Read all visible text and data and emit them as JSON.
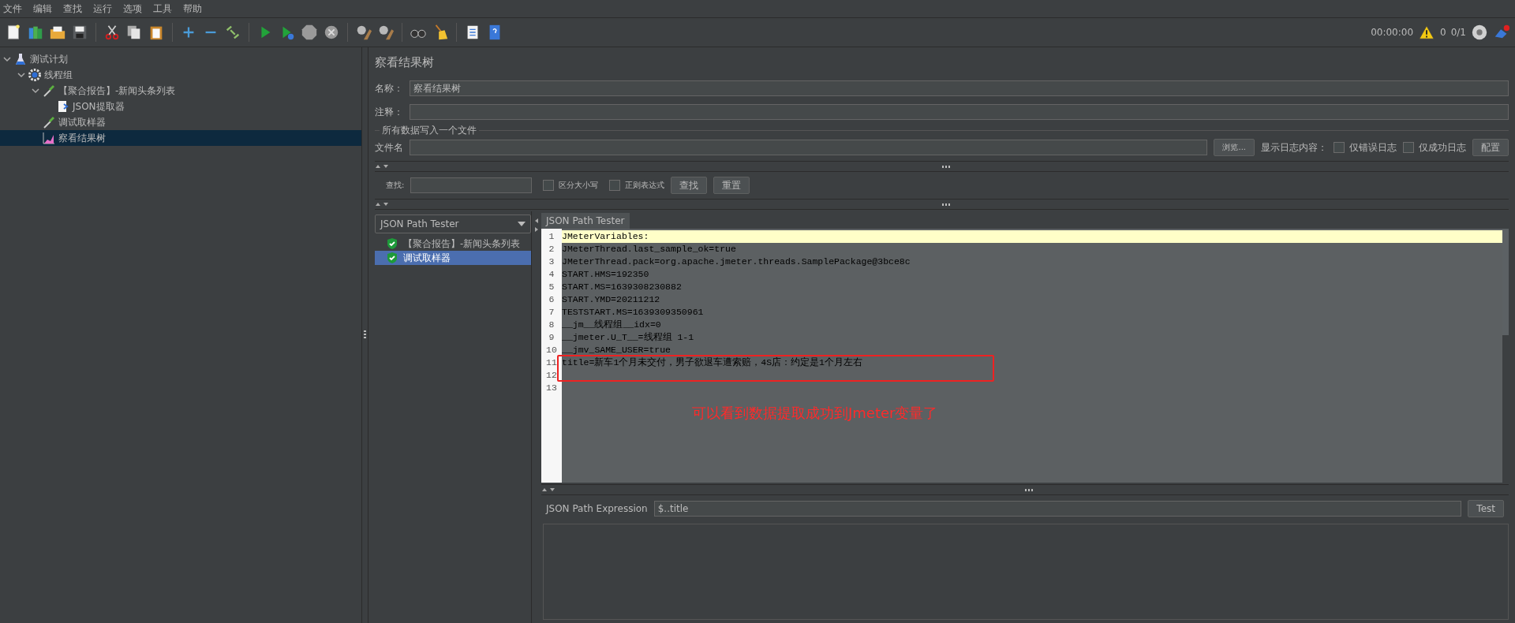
{
  "menu": [
    "文件",
    "编辑",
    "查找",
    "运行",
    "选项",
    "工具",
    "帮助"
  ],
  "status": {
    "time": "00:00:00",
    "warnings": "0",
    "threads": "0/1"
  },
  "tree": [
    {
      "label": "测试计划",
      "kind": "plan",
      "expanded": true,
      "selected": false,
      "children": [
        {
          "label": "线程组",
          "kind": "threads",
          "expanded": true,
          "selected": false,
          "children": [
            {
              "label": "【聚合报告】-新闻头条列表",
              "kind": "sampler",
              "expanded": true,
              "selected": false,
              "children": [
                {
                  "label": "JSON提取器",
                  "kind": "extractor",
                  "selected": false
                }
              ]
            },
            {
              "label": "调试取样器",
              "kind": "sampler",
              "selected": false
            },
            {
              "label": "察看结果树",
              "kind": "listener",
              "selected": true
            }
          ]
        }
      ]
    }
  ],
  "panel": {
    "title": "察看结果树",
    "name_label": "名称：",
    "name_value": "察看结果树",
    "comment_label": "注释：",
    "file_group": "所有数据写入一个文件",
    "file_label": "文件名",
    "browse": "浏览...",
    "log_label": "显示日志内容：",
    "log_options": [
      {
        "label": "仅错误日志",
        "checked": false
      },
      {
        "label": "仅成功日志",
        "checked": false
      }
    ],
    "config": "配置"
  },
  "search": {
    "label": "查找:",
    "options": [
      {
        "label": "区分大小写",
        "checked": false
      },
      {
        "label": "正则表达式",
        "checked": false
      }
    ],
    "find": "查找",
    "reset": "重置"
  },
  "renderer": "JSON Path Tester",
  "results": [
    {
      "label": "【聚合报告】-新闻头条列表",
      "selected": false
    },
    {
      "label": "调试取样器",
      "selected": true
    }
  ],
  "tab": "JSON Path Tester",
  "lines": [
    {
      "number": "1",
      "text": "JMeterVariables:",
      "current": true
    },
    {
      "number": "2",
      "text": "JMeterThread.last_sample_ok=true",
      "current": false
    },
    {
      "number": "3",
      "text": "JMeterThread.pack=org.apache.jmeter.threads.SamplePackage@3bce8c",
      "current": false
    },
    {
      "number": "4",
      "text": "START.HMS=192350",
      "current": false
    },
    {
      "number": "5",
      "text": "START.MS=1639308230882",
      "current": false
    },
    {
      "number": "6",
      "text": "START.YMD=20211212",
      "current": false
    },
    {
      "number": "7",
      "text": "TESTSTART.MS=1639309350961",
      "current": false
    },
    {
      "number": "8",
      "text": "__jm__线程组__idx=0",
      "current": false
    },
    {
      "number": "9",
      "text": "__jmeter.U_T__=线程组 1-1",
      "current": false
    },
    {
      "number": "10",
      "text": "__jmv_SAME_USER=true",
      "current": false
    },
    {
      "number": "11",
      "text": "title=新车1个月未交付，男子欲退车遭索赔，4S店：约定是1个月左右",
      "current": false
    },
    {
      "number": "12",
      "current": false
    },
    {
      "number": "13",
      "current": false
    }
  ],
  "annotation": "可以看到数据提取成功到Jmeter变量了",
  "expression": {
    "label": "JSON Path Expression",
    "value": "$..title",
    "button": "Test"
  }
}
